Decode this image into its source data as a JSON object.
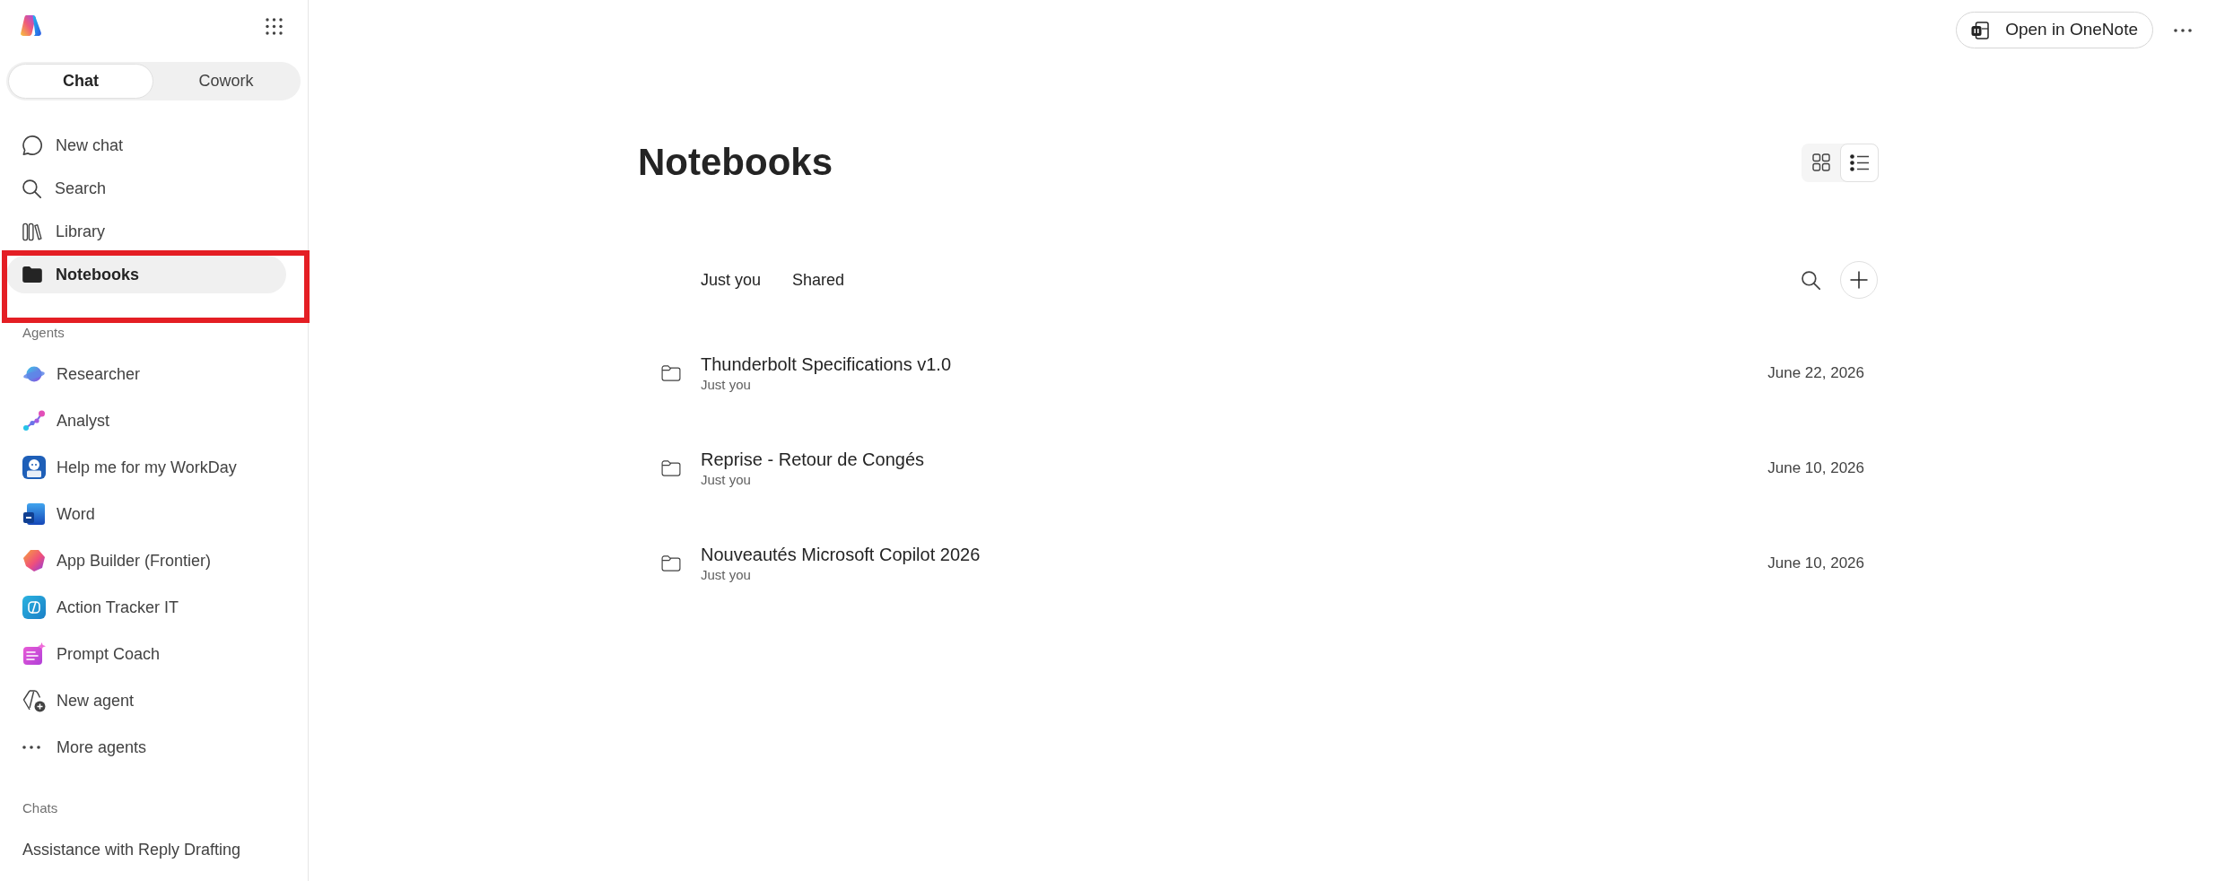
{
  "sidebar": {
    "mode_toggle": [
      {
        "label": "Chat",
        "selected": true
      },
      {
        "label": "Cowork",
        "selected": false
      }
    ],
    "nav": [
      {
        "label": "New chat",
        "selected": false
      },
      {
        "label": "Search",
        "selected": false
      },
      {
        "label": "Library",
        "selected": false
      },
      {
        "label": "Notebooks",
        "selected": true
      }
    ],
    "agents_heading": "Agents",
    "agents": [
      "Researcher",
      "Analyst",
      "Help me for my WorkDay",
      "Word",
      "App Builder (Frontier)",
      "Action Tracker IT",
      "Prompt Coach",
      "New agent",
      "More agents"
    ],
    "chats_heading": "Chats",
    "chats": [
      "Assistance with Reply Drafting"
    ]
  },
  "top_bar": {
    "button": "Open in OneNote"
  },
  "page": {
    "title": "Notebooks",
    "view_toggle": [
      {
        "selected": false
      },
      {
        "selected": true
      }
    ],
    "filters": [
      "Just you",
      "Shared"
    ],
    "notebooks": [
      {
        "title": "Thunderbolt Specifications v1.0",
        "shared_with": "Just you",
        "date": "June 22, 2026"
      },
      {
        "title": "Reprise - Retour de Congés",
        "shared_with": "Just you",
        "date": "June 10, 2026"
      },
      {
        "title": "Nouveautés Microsoft Copilot 2026",
        "shared_with": "Just you",
        "date": "June 10, 2026"
      }
    ]
  },
  "annotation": {
    "kind": "rectangle"
  }
}
